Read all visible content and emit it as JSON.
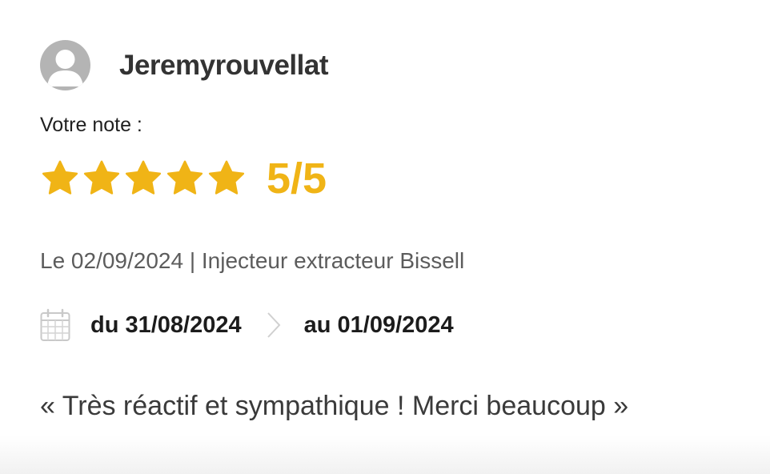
{
  "review": {
    "username": "Jeremyrouvellat",
    "rating_label": "Votre note :",
    "stars_filled": 5,
    "stars_total": 5,
    "score_text": "5/5",
    "meta_text": "Le 02/09/2024 | Injecteur extracteur Bissell",
    "date_from": "du 31/08/2024",
    "date_to": "au 01/09/2024",
    "comment": "« Très réactif et sympathique ! Merci beaucoup »"
  },
  "colors": {
    "star": "#f0b416",
    "avatar_bg": "#b4b4b4",
    "avatar_fg": "#ffffff"
  },
  "icons": {
    "avatar": "user-silhouette-icon",
    "calendar": "calendar-icon",
    "separator": "chevron-right-icon"
  }
}
